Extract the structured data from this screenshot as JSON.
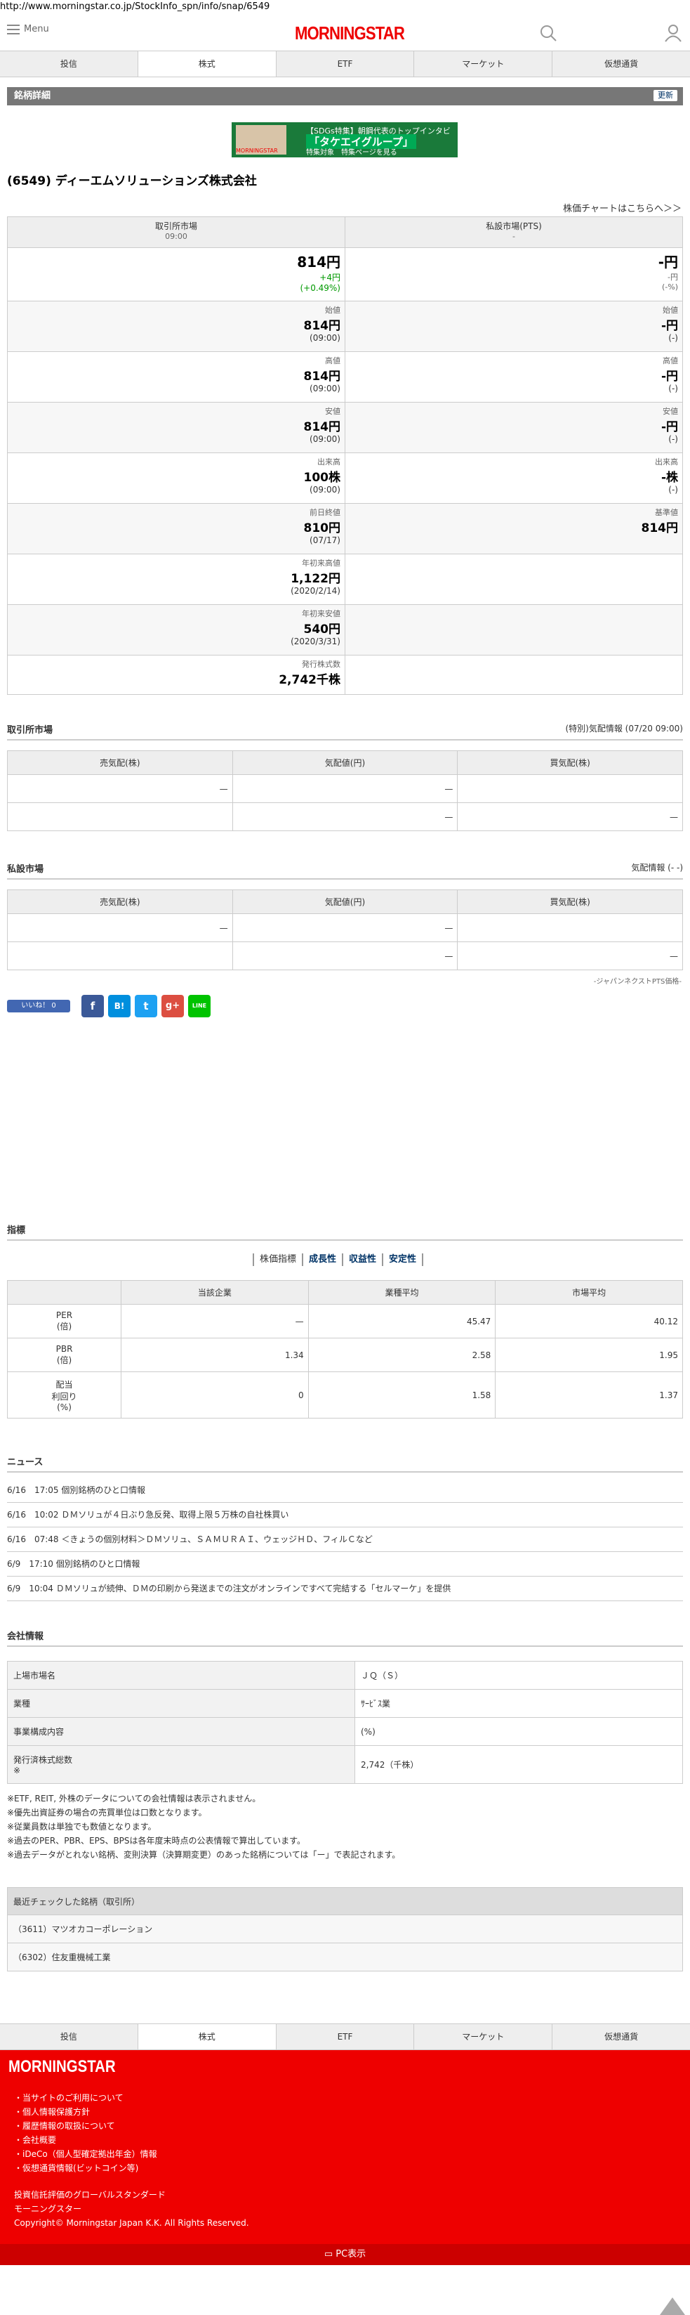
{
  "url": "http://www.morningstar.co.jp/StockInfo_spn/info/snap/6549",
  "header": {
    "menu_label": "Menu",
    "logo": "MORNINGSTAR"
  },
  "nav": [
    "投信",
    "株式",
    "ETF",
    "マーケット",
    "仮想通貨"
  ],
  "titlebar": {
    "title": "銘柄詳細",
    "refresh": "更新"
  },
  "ad": {
    "line1": "【SDGs特集】朝鋼代表のトップインタビュー",
    "line2": "「タケエイグループ」",
    "tag": "特集対象",
    "line3": "特集ページを見る",
    "brand": "MORNINGSTAR"
  },
  "stock": {
    "name": "(6549) ディーエムソリューションズ株式会社",
    "chart_link": "株価チャートはこちらへ＞＞"
  },
  "quote": {
    "left_head": "取引所市場",
    "left_time": "09:00",
    "right_head": "私設市場(PTS)",
    "right_time": "-",
    "price": "814円",
    "change": "+4円",
    "change_pct": "(+0.49%)",
    "pts_price": "-円",
    "pts_change": "-円",
    "pts_change_pct": "(-%)",
    "rows": [
      {
        "label": "始値",
        "value": "814円",
        "time": "(09:00)",
        "pts_label": "始値",
        "pts_value": "-円",
        "pts_time": "(-)"
      },
      {
        "label": "高値",
        "value": "814円",
        "time": "(09:00)",
        "pts_label": "高値",
        "pts_value": "-円",
        "pts_time": "(-)"
      },
      {
        "label": "安値",
        "value": "814円",
        "time": "(09:00)",
        "pts_label": "安値",
        "pts_value": "-円",
        "pts_time": "(-)"
      },
      {
        "label": "出来高",
        "value": "100株",
        "time": "(09:00)",
        "pts_label": "出来高",
        "pts_value": "-株",
        "pts_time": "(-)"
      },
      {
        "label": "前日終値",
        "value": "810円",
        "time": "(07/17)",
        "pts_label": "基準値",
        "pts_value": "814円",
        "pts_time": ""
      },
      {
        "label": "年初来高値",
        "value": "1,122円",
        "time": "(2020/2/14)"
      },
      {
        "label": "年初来安値",
        "value": "540円",
        "time": "(2020/3/31)"
      },
      {
        "label": "発行株式数",
        "value": "2,742千株",
        "time": ""
      }
    ]
  },
  "exchange": {
    "title": "取引所市場",
    "info": "(特別)気配情報 (07/20 09:00)"
  },
  "pts": {
    "title": "私設市場",
    "info": "気配情報 (- -)",
    "note": "-ジャパンネクストPTS価格-"
  },
  "book": {
    "sell": "売気配(株)",
    "price": "気配値(円)",
    "buy": "買気配(株)",
    "dash": "—"
  },
  "social": {
    "fb": "いいね！ 0",
    "hatena": "B!",
    "twitter": "t",
    "gplus": "g+",
    "line": "LINE"
  },
  "indicators": {
    "title": "指標",
    "tabs": [
      "株価指標",
      "成長性",
      "収益性",
      "安定性"
    ],
    "cols": [
      "",
      "当該企業",
      "業種平均",
      "市場平均"
    ],
    "rows": [
      {
        "k1": "PER",
        "k2": "(倍)",
        "v": [
          "—",
          "45.47",
          "40.12"
        ]
      },
      {
        "k1": "PBR",
        "k2": "(倍)",
        "v": [
          "1.34",
          "2.58",
          "1.95"
        ]
      },
      {
        "k1": "配当",
        "k2": "利回り",
        "k3": "(%)",
        "v": [
          "0",
          "1.58",
          "1.37"
        ]
      }
    ]
  },
  "news": {
    "title": "ニュース",
    "items": [
      "6/16　17:05 個別銘柄のひと口情報",
      "6/16　10:02 ＤＭソリュが４日ぶり急反発、取得上限５万株の自社株買い",
      "6/16　07:48 ＜きょうの個別材料＞ＤＭソリュ、ＳＡＭＵＲＡＩ、ウェッジＨＤ、フィルＣなど",
      "6/9　17:10 個別銘柄のひと口情報",
      "6/9　10:04 ＤＭソリュが続伸、ＤＭの印刷から発送までの注文がオンラインですべて完結する「セルマーケ」を提供"
    ]
  },
  "company": {
    "title": "会社情報",
    "rows": [
      {
        "k": "上場市場名",
        "v": "ＪＱ（Ｓ）"
      },
      {
        "k": "業種",
        "v": "ｻｰﾋﾞｽ業"
      },
      {
        "k": "事業構成内容",
        "v": "(%)"
      },
      {
        "k": "発行済株式総数",
        "k2": "※",
        "v": "2,742（千株）"
      }
    ]
  },
  "footnotes": [
    "※ETF, REIT, 外株のデータについての会社情報は表示されません。",
    "※優先出資証券の場合の売買単位は口数となります。",
    "※従業員数は単独でも数値となります。",
    "※過去のPER、PBR、EPS、BPSは各年度末時点の公表情報で算出しています。",
    "※過去データがとれない銘柄、変則決算（決算期変更）のあった銘柄については「ー」で表記されます。"
  ],
  "recent": {
    "title": "最近チェックした銘柄（取引所）",
    "items": [
      "（3611）マツオカコーポレーション",
      "（6302）住友重機械工業"
    ]
  },
  "footer": {
    "logo": "MORNINGSTAR",
    "links": [
      "・当サイトのご利用について",
      "・個人情報保護方針",
      "・履歴情報の取扱について",
      "・会社概要",
      "・iDeCo（個人型確定拠出年金）情報",
      "・仮想通貨情報(ビットコイン等)"
    ],
    "corp": [
      "投資信託評価のグローバルスタンダード",
      "モーニングスター",
      "Copyright© Morningstar Japan K.K. All Rights Reserved."
    ],
    "pc": "PC表示"
  },
  "colors": {
    "brand": "#e00000",
    "positive": "#009900",
    "link": "#003366"
  }
}
